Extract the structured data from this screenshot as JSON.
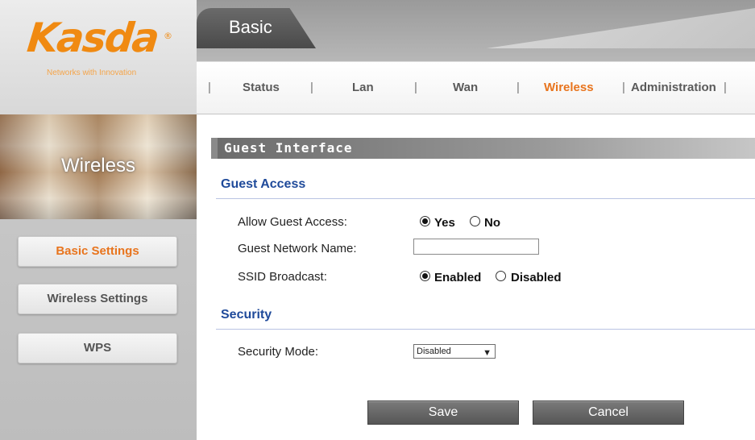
{
  "brand": {
    "logo": "Kasda",
    "registered_mark": "®",
    "tagline": "Networks with Innovation"
  },
  "header": {
    "active_tab": "Basic",
    "nav": [
      {
        "label": "Status"
      },
      {
        "label": "Lan"
      },
      {
        "label": "Wan"
      },
      {
        "label": "Wireless",
        "active": true
      },
      {
        "label": "Administration"
      }
    ],
    "separator": "|"
  },
  "sidebar": {
    "section_title": "Wireless",
    "items": [
      {
        "label": "Basic Settings",
        "active": true
      },
      {
        "label": "Wireless Settings"
      },
      {
        "label": "WPS"
      }
    ]
  },
  "panel": {
    "title": "Guest Interface",
    "guest_access": {
      "heading": "Guest Access",
      "allow_label": "Allow Guest Access:",
      "allow_options": [
        "Yes",
        "No"
      ],
      "allow_selected": "Yes",
      "network_name_label": "Guest Network Name:",
      "network_name_value": "",
      "ssid_label": "SSID Broadcast:",
      "ssid_options": [
        "Enabled",
        "Disabled"
      ],
      "ssid_selected": "Enabled"
    },
    "security": {
      "heading": "Security",
      "mode_label": "Security Mode:",
      "mode_value": "Disabled"
    },
    "buttons": {
      "save": "Save",
      "cancel": "Cancel"
    }
  },
  "colors": {
    "accent": "#e8741d",
    "section_heading": "#1f4a9a",
    "logo": "#f08a12"
  }
}
